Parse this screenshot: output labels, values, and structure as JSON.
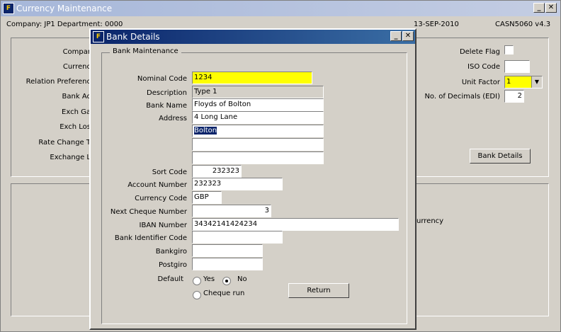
{
  "main_window": {
    "title": "Currency Maintenance",
    "company_text": "Company: JP1  Department: 0000",
    "date": "13-SEP-2010",
    "form_id": "CASN5060  v4.3",
    "labels": {
      "company": "Compar",
      "currency": "Currenc",
      "relation": "Relation Preferenc",
      "bank_ac": "Bank Ac",
      "exch_ga": "Exch Ga",
      "exch_los": "Exch Los",
      "rate_change": "Rate Change T",
      "exchange_la": "Exchange L",
      "delete_flag": "Delete Flag",
      "iso_code": "ISO Code",
      "unit_factor": "Unit Factor",
      "decimals": "No. of Decimals (EDI)",
      "currency_right": "urrency"
    },
    "values": {
      "unit_factor": "1",
      "decimals": "2",
      "iso_code": ""
    },
    "bank_details_button": "Bank Details"
  },
  "dialog": {
    "title": "Bank Details",
    "group_title": "Bank Maintenance",
    "fields": {
      "nominal_code": {
        "label": "Nominal Code",
        "value": "1234"
      },
      "description": {
        "label": "Description",
        "value": "Type 1"
      },
      "bank_name": {
        "label": "Bank Name",
        "value": "Floyds of Bolton"
      },
      "address": {
        "label": "Address",
        "lines": [
          "4 Long Lane",
          "Bolton",
          "",
          ""
        ]
      },
      "sort_code": {
        "label": "Sort Code",
        "value": "232323"
      },
      "account_number": {
        "label": "Account Number",
        "value": "232323"
      },
      "currency_code": {
        "label": "Currency Code",
        "value": "GBP"
      },
      "next_cheque": {
        "label": "Next Cheque Number",
        "value": "3"
      },
      "iban": {
        "label": "IBAN Number",
        "value": "34342141424234"
      },
      "bic": {
        "label": "Bank Identifier Code",
        "value": ""
      },
      "bankgiro": {
        "label": "Bankgiro",
        "value": ""
      },
      "postgiro": {
        "label": "Postgiro",
        "value": ""
      }
    },
    "default_label": "Default",
    "radio_yes": "Yes",
    "radio_no": "No",
    "radio_cheque": "Cheque run",
    "return_button": "Return"
  }
}
